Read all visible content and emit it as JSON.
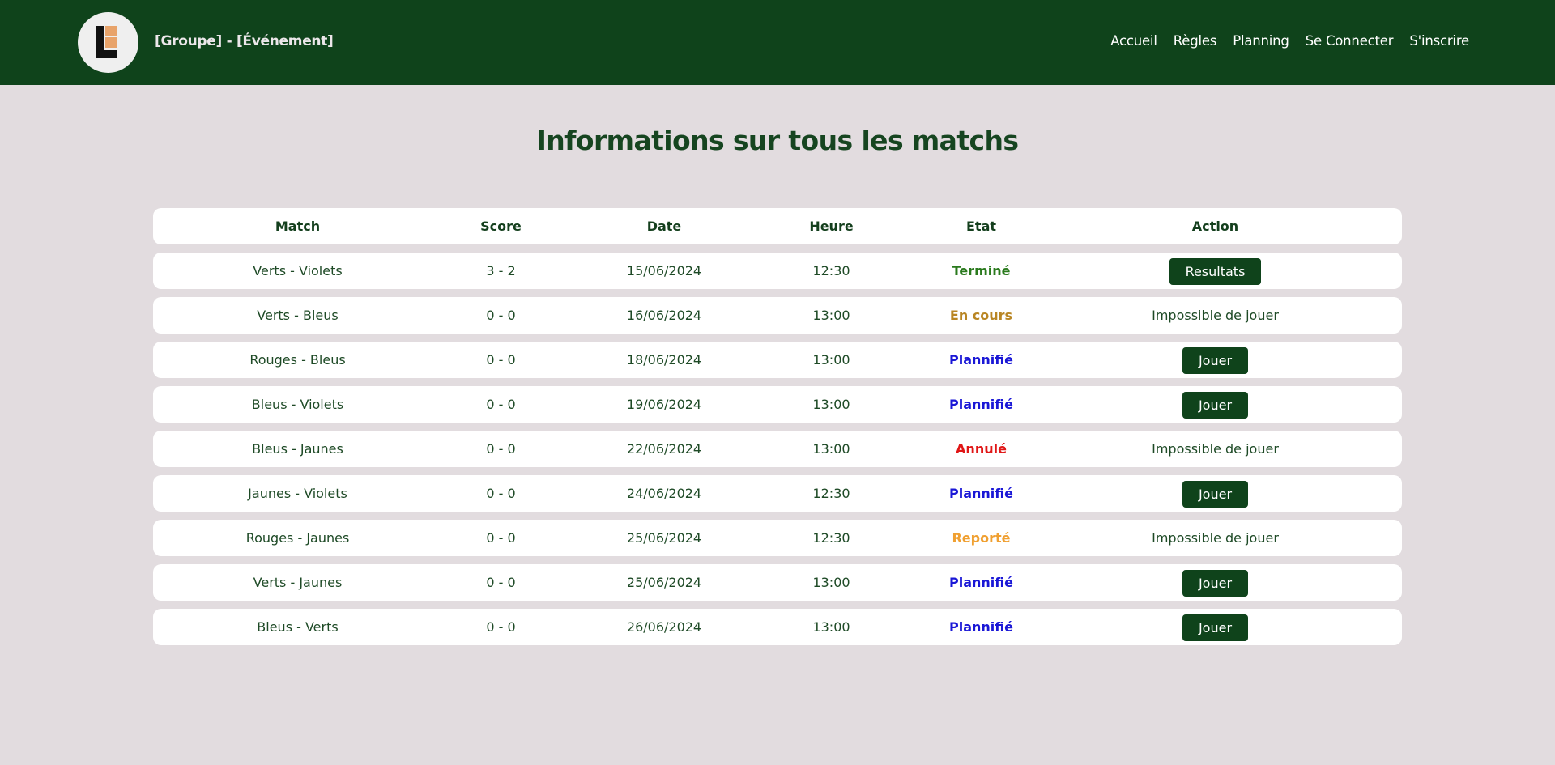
{
  "header": {
    "brand": "[Groupe] - [Événement]",
    "logo_icon": "logo-icon",
    "nav": [
      "Accueil",
      "Règles",
      "Planning",
      "Se Connecter",
      "S'inscrire"
    ]
  },
  "page_title": "Informations sur tous les matchs",
  "table": {
    "columns": [
      "Match",
      "Score",
      "Date",
      "Heure",
      "Etat",
      "Action"
    ],
    "rows": [
      {
        "match": "Verts - Violets",
        "score": "3 - 2",
        "date": "15/06/2024",
        "heure": "12:30",
        "etat": "Terminé",
        "etat_color": "#2a7a1d",
        "action": "Resultats",
        "action_is_button": true
      },
      {
        "match": "Verts - Bleus",
        "score": "0 - 0",
        "date": "16/06/2024",
        "heure": "13:00",
        "etat": "En cours",
        "etat_color": "#b98624",
        "action": "Impossible de jouer",
        "action_is_button": false
      },
      {
        "match": "Rouges - Bleus",
        "score": "0 - 0",
        "date": "18/06/2024",
        "heure": "13:00",
        "etat": "Plannifié",
        "etat_color": "#1a17d6",
        "action": "Jouer",
        "action_is_button": true
      },
      {
        "match": "Bleus - Violets",
        "score": "0 - 0",
        "date": "19/06/2024",
        "heure": "13:00",
        "etat": "Plannifié",
        "etat_color": "#1a17d6",
        "action": "Jouer",
        "action_is_button": true
      },
      {
        "match": "Bleus - Jaunes",
        "score": "0 - 0",
        "date": "22/06/2024",
        "heure": "13:00",
        "etat": "Annulé",
        "etat_color": "#e01616",
        "action": "Impossible de jouer",
        "action_is_button": false
      },
      {
        "match": "Jaunes - Violets",
        "score": "0 - 0",
        "date": "24/06/2024",
        "heure": "12:30",
        "etat": "Plannifié",
        "etat_color": "#1a17d6",
        "action": "Jouer",
        "action_is_button": true
      },
      {
        "match": "Rouges - Jaunes",
        "score": "0 - 0",
        "date": "25/06/2024",
        "heure": "12:30",
        "etat": "Reporté",
        "etat_color": "#f0a031",
        "action": "Impossible de jouer",
        "action_is_button": false
      },
      {
        "match": "Verts - Jaunes",
        "score": "0 - 0",
        "date": "25/06/2024",
        "heure": "13:00",
        "etat": "Plannifié",
        "etat_color": "#1a17d6",
        "action": "Jouer",
        "action_is_button": true
      },
      {
        "match": "Bleus - Verts",
        "score": "0 - 0",
        "date": "26/06/2024",
        "heure": "13:00",
        "etat": "Plannifié",
        "etat_color": "#1a17d6",
        "action": "Jouer",
        "action_is_button": true
      }
    ]
  },
  "colors": {
    "header_bg": "#0f431b",
    "page_bg": "#e2dcdf",
    "button_bg": "#0f431b",
    "text": "#1e4a26"
  }
}
